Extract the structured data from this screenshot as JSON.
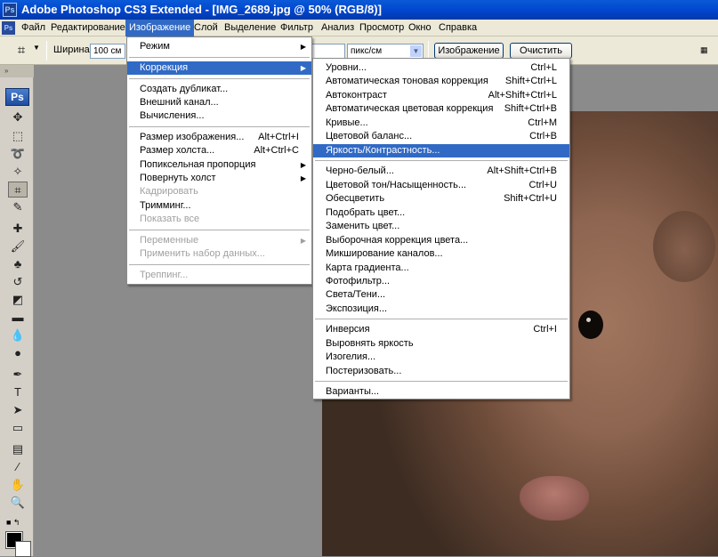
{
  "window": {
    "title": "Adobe Photoshop CS3 Extended - [IMG_2689.jpg @ 50% (RGB/8)]",
    "app_icon": "Ps"
  },
  "menubar": {
    "app_icon": "Ps",
    "items": [
      "Файл",
      "Редактирование",
      "Изображение",
      "Слой",
      "Выделение",
      "Фильтр",
      "Анализ",
      "Просмотр",
      "Окно",
      "Справка"
    ]
  },
  "options": {
    "width_label": "Ширина:",
    "width_value": "100 см",
    "resolution_unit": "пикс/см",
    "image_button": "Изображение",
    "clear_button": "Очистить"
  },
  "toolbar": {
    "logo": "Ps"
  },
  "image_menu": {
    "items": [
      {
        "label": "Режим",
        "submenu": true
      },
      {
        "label": "Коррекция",
        "submenu": true,
        "highlighted": true
      },
      {
        "label": "Создать дубликат..."
      },
      {
        "label": "Внешний канал..."
      },
      {
        "label": "Вычисления..."
      },
      {
        "label": "Размер изображения...",
        "shortcut": "Alt+Ctrl+I"
      },
      {
        "label": "Размер холста...",
        "shortcut": "Alt+Ctrl+C"
      },
      {
        "label": "Попиксельная пропорция",
        "submenu": true
      },
      {
        "label": "Повернуть холст",
        "submenu": true
      },
      {
        "label": "Кадрировать",
        "disabled": true
      },
      {
        "label": "Тримминг..."
      },
      {
        "label": "Показать все",
        "disabled": true
      },
      {
        "label": "Переменные",
        "submenu": true,
        "disabled": true
      },
      {
        "label": "Применить набор данных...",
        "disabled": true
      },
      {
        "label": "Треппинг...",
        "disabled": true
      }
    ]
  },
  "adjust_menu": {
    "items": [
      {
        "label": "Уровни...",
        "shortcut": "Ctrl+L"
      },
      {
        "label": "Автоматическая тоновая коррекция",
        "shortcut": "Shift+Ctrl+L"
      },
      {
        "label": "Автоконтраст",
        "shortcut": "Alt+Shift+Ctrl+L"
      },
      {
        "label": "Автоматическая цветовая коррекция",
        "shortcut": "Shift+Ctrl+B"
      },
      {
        "label": "Кривые...",
        "shortcut": "Ctrl+M"
      },
      {
        "label": "Цветовой баланс...",
        "shortcut": "Ctrl+B"
      },
      {
        "label": "Яркость/Контрастность...",
        "highlighted": true
      },
      {
        "label": "Черно-белый...",
        "shortcut": "Alt+Shift+Ctrl+B"
      },
      {
        "label": "Цветовой тон/Насыщенность...",
        "shortcut": "Ctrl+U"
      },
      {
        "label": "Обесцветить",
        "shortcut": "Shift+Ctrl+U"
      },
      {
        "label": "Подобрать цвет..."
      },
      {
        "label": "Заменить цвет..."
      },
      {
        "label": "Выборочная коррекция цвета..."
      },
      {
        "label": "Микширование каналов..."
      },
      {
        "label": "Карта градиента..."
      },
      {
        "label": "Фотофильтр..."
      },
      {
        "label": "Света/Тени..."
      },
      {
        "label": "Экспозиция..."
      },
      {
        "label": "Инверсия",
        "shortcut": "Ctrl+I"
      },
      {
        "label": "Выровнять яркость"
      },
      {
        "label": "Изогелия..."
      },
      {
        "label": "Постеризовать..."
      },
      {
        "label": "Варианты..."
      }
    ]
  },
  "colors": {
    "menu_highlight": "#316ac5",
    "titlebar": "#0044cc",
    "chrome": "#ece9d8",
    "workspace": "#8b8b8b"
  }
}
